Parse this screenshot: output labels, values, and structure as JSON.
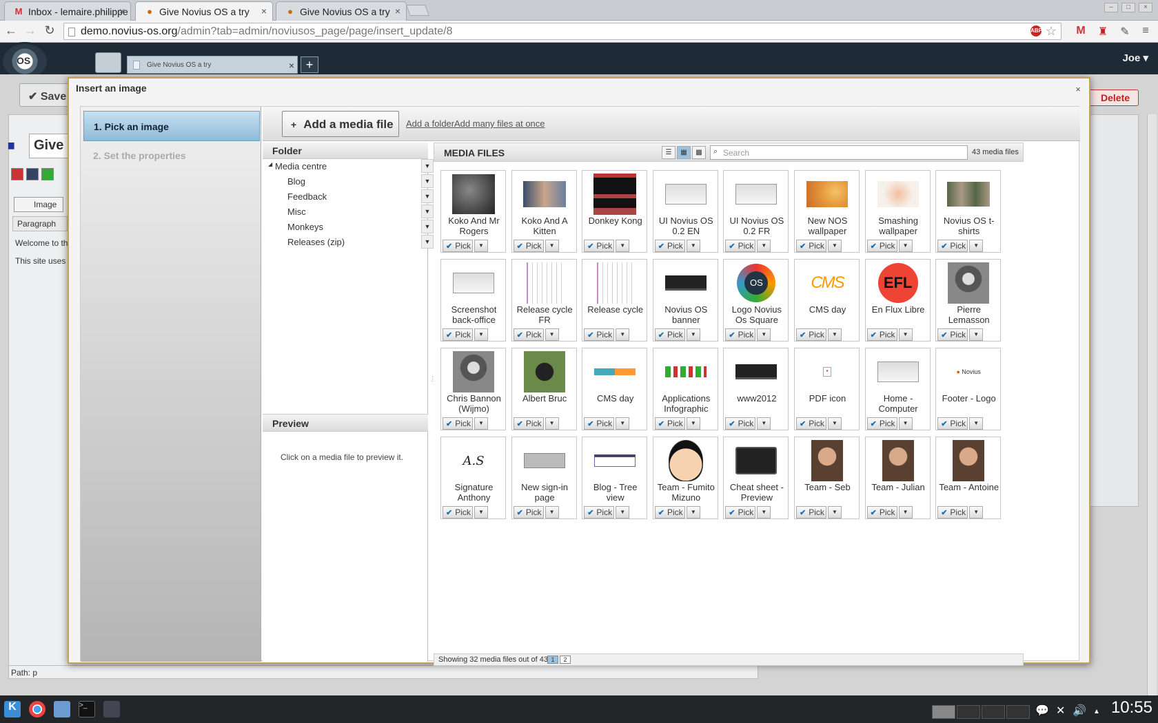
{
  "browser": {
    "tabs": [
      {
        "title": "Inbox - lemaire.philippe",
        "icon": "gmail-icon"
      },
      {
        "title": "Give Novius OS a try",
        "icon": "novius-icon"
      },
      {
        "title": "Give Novius OS a try",
        "icon": "novius-icon"
      }
    ],
    "url_host": "demo.novius-os.org",
    "url_path": "/admin?tab=admin/noviusos_page/page/insert_update/8"
  },
  "app": {
    "tab_title": "Give Novius OS a try",
    "user": "Joe ▾",
    "save_label": "Save",
    "delete_label": "Delete",
    "page_title_fragment": "Give",
    "image_button": "Image",
    "paragraph": "Paragraph",
    "content_line1": "Welcome to th",
    "content_line2": "This site uses",
    "path": "Path: p"
  },
  "dialog": {
    "title": "Insert an image",
    "close": "×",
    "steps": [
      "1. Pick an image",
      "2. Set the properties"
    ],
    "add_media": "Add a media file",
    "add_folder": "Add a folder",
    "add_many": "Add many files at once",
    "folder_header": "Folder",
    "folders": [
      "Media centre",
      "Blog",
      "Feedback",
      "Misc",
      "Monkeys",
      "Releases (zip)"
    ],
    "preview_header": "Preview",
    "preview_text": "Click on a media file to preview it.",
    "media_header": "MEDIA FILES",
    "search_placeholder": "Search",
    "media_count": "43 media files",
    "pick_label": "Pick",
    "media": [
      {
        "name": "Koko And Mr Rogers",
        "thumb": "photo-dark"
      },
      {
        "name": "Koko And A Kitten",
        "thumb": "photo-blue"
      },
      {
        "name": "Donkey Kong",
        "thumb": "game"
      },
      {
        "name": "UI Novius OS 0.2 EN",
        "thumb": "screen-light"
      },
      {
        "name": "UI Novius OS 0.2 FR",
        "thumb": "screen-light"
      },
      {
        "name": "New NOS wallpaper",
        "thumb": "wallpaper-orange"
      },
      {
        "name": "Smashing wallpaper",
        "thumb": "wallpaper-light"
      },
      {
        "name": "Novius OS t-shirts",
        "thumb": "photo-people"
      },
      {
        "name": "Screenshot back-office",
        "thumb": "screen-light"
      },
      {
        "name": "Release cycle FR",
        "thumb": "diagram"
      },
      {
        "name": "Release cycle",
        "thumb": "diagram"
      },
      {
        "name": "Novius OS banner",
        "thumb": "banner-dark"
      },
      {
        "name": "Logo Novius Os Square",
        "thumb": "logo-os"
      },
      {
        "name": "CMS day",
        "thumb": "cms-day"
      },
      {
        "name": "En Flux Libre",
        "thumb": "efl"
      },
      {
        "name": "Pierre Lemasson",
        "thumb": "portrait-bw"
      },
      {
        "name": "Chris Bannon (Wijmo)",
        "thumb": "portrait-bw"
      },
      {
        "name": "Albert Bruc",
        "thumb": "photo-green"
      },
      {
        "name": "CMS day",
        "thumb": "banner-blue"
      },
      {
        "name": "Applications Infographic",
        "thumb": "infographic"
      },
      {
        "name": "www2012",
        "thumb": "banner-dark"
      },
      {
        "name": "PDF icon",
        "thumb": "pdf"
      },
      {
        "name": "Home - Computer",
        "thumb": "screen-light"
      },
      {
        "name": "Footer - Logo",
        "thumb": "novius-small"
      },
      {
        "name": "Signature Anthony",
        "thumb": "signature"
      },
      {
        "name": "New sign-in page",
        "thumb": "screen-gray"
      },
      {
        "name": "Blog - Tree view",
        "thumb": "screen-white"
      },
      {
        "name": "Team - Fumito Mizuno",
        "thumb": "cartoon"
      },
      {
        "name": "Cheat sheet - Preview",
        "thumb": "devices"
      },
      {
        "name": "Team - Seb",
        "thumb": "portrait-color"
      },
      {
        "name": "Team - Julian",
        "thumb": "portrait-color"
      },
      {
        "name": "Team - Antoine",
        "thumb": "portrait-color"
      }
    ],
    "footer_text": "Showing 32 media files out of 43",
    "pages": [
      "1",
      "2"
    ]
  },
  "taskbar": {
    "clock": "10:55"
  }
}
